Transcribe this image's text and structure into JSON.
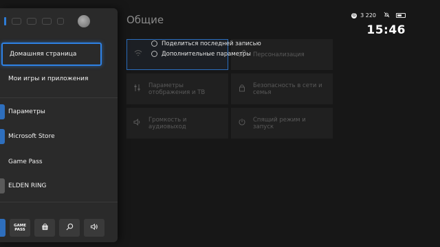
{
  "page": {
    "title": "Общие"
  },
  "status": {
    "score": "3 220",
    "score_icon": "gamerscore-icon",
    "time": "15:46"
  },
  "context_menu": {
    "items": [
      {
        "label": "Поделиться последней записью",
        "icon": "share-icon"
      },
      {
        "label": "Дополнительные параметры",
        "icon": "options-icon"
      }
    ]
  },
  "settings_tiles": [
    {
      "label": "",
      "icon": "network-icon",
      "focused": true
    },
    {
      "label": "Персонализация",
      "icon": "edit-icon"
    },
    {
      "label": "Параметры отображения и ТВ",
      "icon": "display-icon"
    },
    {
      "label": "Безопасность в сети и семья",
      "icon": "lock-icon"
    },
    {
      "label": "Громкость и аудиовыход",
      "icon": "volume-icon"
    },
    {
      "label": "Спящий режим и запуск",
      "icon": "power-icon"
    }
  ],
  "guide": {
    "menu": [
      {
        "label": "Домашняя страница"
      },
      {
        "label": "Мои игры и приложения"
      },
      {
        "label": "Параметры",
        "accent": "#2e6fbe"
      },
      {
        "label": "Microsoft Store",
        "accent": "#2e6fbe"
      },
      {
        "label": "Game Pass"
      },
      {
        "label": "ELDEN RING",
        "accent": "#5a5a5a"
      }
    ],
    "bottom_buttons": [
      {
        "icon": "gamepass-icon",
        "label": "GAME PASS"
      },
      {
        "icon": "store-icon"
      },
      {
        "icon": "search-icon"
      },
      {
        "icon": "volume-icon"
      }
    ]
  },
  "colors": {
    "accent": "#2e82e6",
    "background": "#171717",
    "guide": "#2a2a2a"
  }
}
